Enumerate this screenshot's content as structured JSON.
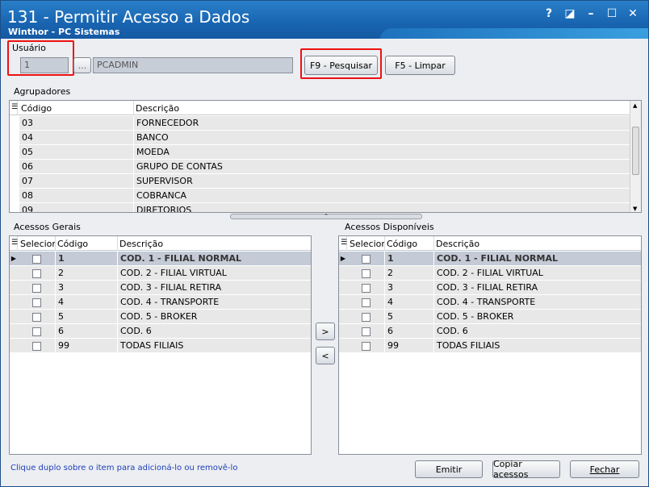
{
  "window": {
    "title": "131 - Permitir Acesso a Dados",
    "subtitle": "Winthor - PC Sistemas",
    "icons": [
      "help-icon",
      "restore-icon",
      "minimize-icon",
      "maximize-icon",
      "close-icon"
    ],
    "icon_glyphs": [
      "?",
      "◪",
      "–",
      "☐",
      "✕"
    ]
  },
  "usuario": {
    "label": "Usuário",
    "code": "1",
    "browse": "...",
    "name": "PCADMIN"
  },
  "buttons": {
    "pesquisar": "F9 - Pesquisar",
    "limpar": "F5 - Limpar",
    "add": ">",
    "remove": "<",
    "emitir": "Emitir",
    "copiar": "Copiar acessos",
    "fechar": "Fechar"
  },
  "agrupadores": {
    "label": "Agrupadores",
    "columns": [
      "Código",
      "Descrição"
    ],
    "rows": [
      [
        "03",
        "FORNECEDOR"
      ],
      [
        "04",
        "BANCO"
      ],
      [
        "05",
        "MOEDA"
      ],
      [
        "06",
        "GRUPO DE CONTAS"
      ],
      [
        "07",
        "SUPERVISOR"
      ],
      [
        "08",
        "COBRANCA"
      ],
      [
        "09",
        "DIRETORIOS"
      ]
    ]
  },
  "acessos_gerais": {
    "label": "Acessos Gerais",
    "columns": [
      "Selecionar",
      "Código",
      "Descrição"
    ],
    "rows": [
      [
        "1",
        "COD. 1 - FILIAL NORMAL"
      ],
      [
        "2",
        "COD. 2 - FILIAL VIRTUAL"
      ],
      [
        "3",
        "COD. 3 - FILIAL RETIRA"
      ],
      [
        "4",
        "COD. 4 - TRANSPORTE"
      ],
      [
        "5",
        "COD. 5 - BROKER"
      ],
      [
        "6",
        "COD. 6"
      ],
      [
        "99",
        "TODAS FILIAIS"
      ]
    ]
  },
  "acessos_disponiveis": {
    "label": "Acessos Disponíveis",
    "columns": [
      "Selecionar",
      "Código",
      "Descrição"
    ],
    "rows": [
      [
        "1",
        "COD. 1 - FILIAL NORMAL"
      ],
      [
        "2",
        "COD. 2 - FILIAL VIRTUAL"
      ],
      [
        "3",
        "COD. 3 - FILIAL RETIRA"
      ],
      [
        "4",
        "COD. 4 - TRANSPORTE"
      ],
      [
        "5",
        "COD. 5 - BROKER"
      ],
      [
        "6",
        "COD. 6"
      ],
      [
        "99",
        "TODAS FILIAIS"
      ]
    ]
  },
  "hint": "Clique duplo sobre o item para adicioná-lo ou removê-lo",
  "colors": {
    "title_bar": "#1864b0",
    "highlight": "#e11111",
    "hint": "#1f3eb6",
    "selected_row": "#c4cad6"
  }
}
